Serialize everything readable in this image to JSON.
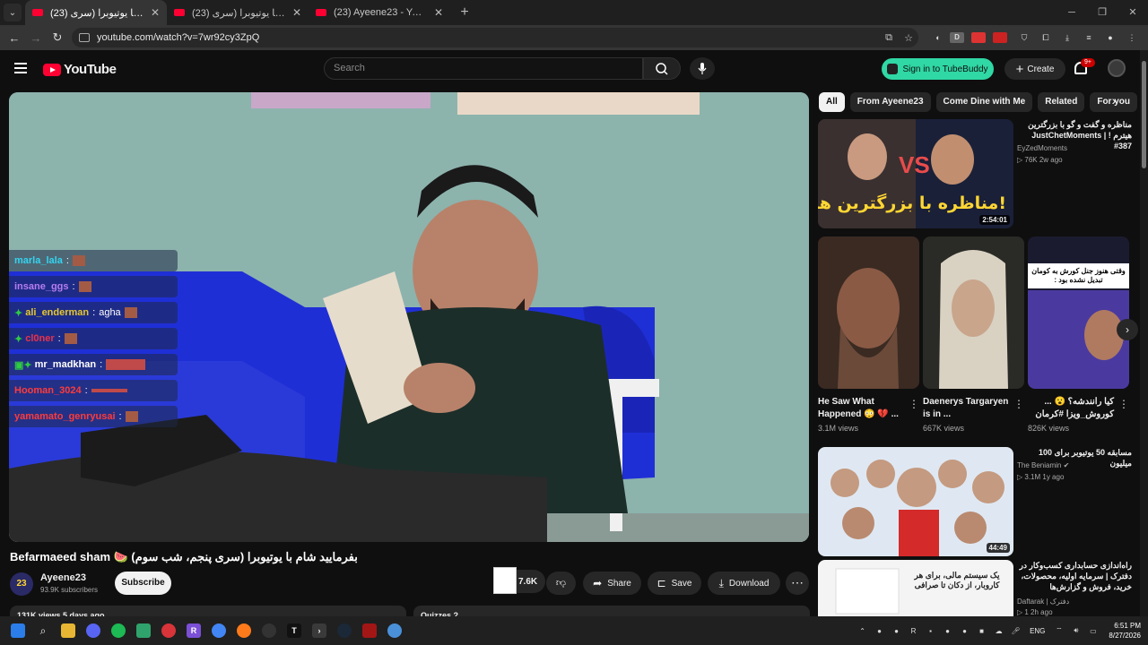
{
  "browser": {
    "tabs": [
      {
        "title": "(23) بفرمایید شام با یوتیوبرا (سری",
        "active": true
      },
      {
        "title": "(23) بفرمایید شام با یوتیوبرا (سری",
        "active": false
      },
      {
        "title": "(23) Ayeene23 - YouTube",
        "active": false
      }
    ],
    "new_tab_glyph": "+",
    "url": "youtube.com/watch?v=7wr92cy3ZpQ",
    "extensions": [
      "D"
    ]
  },
  "masthead": {
    "logo_text": "YouTube",
    "search_placeholder": "Search",
    "tubebuddy_label": "Sign in to TubeBuddy",
    "create_label": "Create",
    "notification_badge": "9+"
  },
  "chat": [
    {
      "user": "marla_lala",
      "color": "#33d4f0",
      "msg": "",
      "prefix": ""
    },
    {
      "user": "insane_ggs",
      "color": "#b67cf0",
      "msg": "",
      "prefix": ""
    },
    {
      "user": "ali_enderman",
      "color": "#e6c72e",
      "msg": "agha",
      "prefix": "✦"
    },
    {
      "user": "cl0ner",
      "color": "#e8324a",
      "msg": "",
      "prefix": "✦"
    },
    {
      "user": "mr_madkhan",
      "color": "#ffffff",
      "msg": "",
      "prefix": "▣✦"
    },
    {
      "user": "Hooman_3024",
      "color": "#ff3b3b",
      "msg": "",
      "prefix": ""
    },
    {
      "user": "yamamato_genryusai",
      "color": "#ff3b3b",
      "msg": "",
      "prefix": ""
    }
  ],
  "video": {
    "title": "بفرمایید شام با یوتیوبرا (سری پنجم، شب سوم) 🍉 Befarmaeed sham",
    "channel": "Ayeene23",
    "channel_avatar_text": "23",
    "subscribers": "93.9K subscribers",
    "subscribe_label": "Subscribe",
    "likes": "7.6K",
    "share_label": "Share",
    "save_label": "Save",
    "download_label": "Download",
    "description_peek": "131K views  5 days ago",
    "quizzes_label": "Quizzes ?"
  },
  "chips": [
    "All",
    "From Ayeene23",
    "Come Dine with Me",
    "Related",
    "For you"
  ],
  "recommendations": [
    {
      "title": "مناظره و گفت و گو با بزرگترین هیترم ! | JustChetMoments #387",
      "channel": "EyZedMoments",
      "meta": "▷ 76K  2w ago",
      "duration": "2:54:01",
      "thumb_text": "مناظره با بزرگترین هیترم!",
      "vs": "VS"
    },
    {
      "title": "مسابقه 50 یوتیوبر برای 100 میلیون",
      "channel": "The Beniamin ✔",
      "meta": "▷ 3.1M  1y ago",
      "duration": "44:49",
      "thumb_text": ""
    },
    {
      "title": "راه‌اندازی حسابداری کسب‌وکار در دفترک | سرمایه اولیه، محصولات، خرید، فروش و گزارش‌ها",
      "channel": "Daftarak | دفترک",
      "meta": "▷ 1  2h ago",
      "duration": "",
      "thumb_text": "یک سیستم مالی، برای هر کاروبار، از دکان تا صرافی"
    }
  ],
  "shorts": [
    {
      "title": "He Saw What Happened 😳 💔 ...",
      "views": "3.1M views"
    },
    {
      "title": "Daenerys Targaryen is in ...",
      "views": "667K views"
    },
    {
      "title": "کیا رانندشه؟ 😮 ... کوروش_ویزا #کرمان",
      "views": "826K views",
      "overlay": "وقتی هنوز جنل کورش به کومان تبدیل نشده بود :"
    }
  ],
  "taskbar": {
    "lang": "ENG",
    "time": "6:51 PM",
    "date": "8/27/2026"
  }
}
